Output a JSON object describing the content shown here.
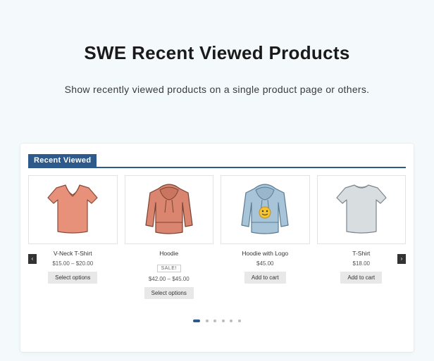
{
  "title": "SWE Recent Viewed Products",
  "description": "Show recently viewed products on a single product page or others.",
  "section_label": "Recent Viewed",
  "accent_color": "#2d5a8b",
  "nav": {
    "prev_glyph": "‹",
    "next_glyph": "›"
  },
  "products": [
    {
      "name": "V-Neck T-Shirt",
      "price": "$15.00 – $20.00",
      "button": "Select options",
      "sale": false,
      "icon": "vneck-tshirt"
    },
    {
      "name": "Hoodie",
      "price": "$42.00 – $45.00",
      "button": "Select options",
      "sale": true,
      "sale_label": "SALE!",
      "icon": "hoodie"
    },
    {
      "name": "Hoodie with Logo",
      "price": "$45.00",
      "button": "Add to cart",
      "sale": false,
      "icon": "hoodie-logo"
    },
    {
      "name": "T-Shirt",
      "price": "$18.00",
      "button": "Add to cart",
      "sale": false,
      "icon": "tshirt"
    }
  ],
  "pagination": {
    "count": 6,
    "active": 0
  }
}
